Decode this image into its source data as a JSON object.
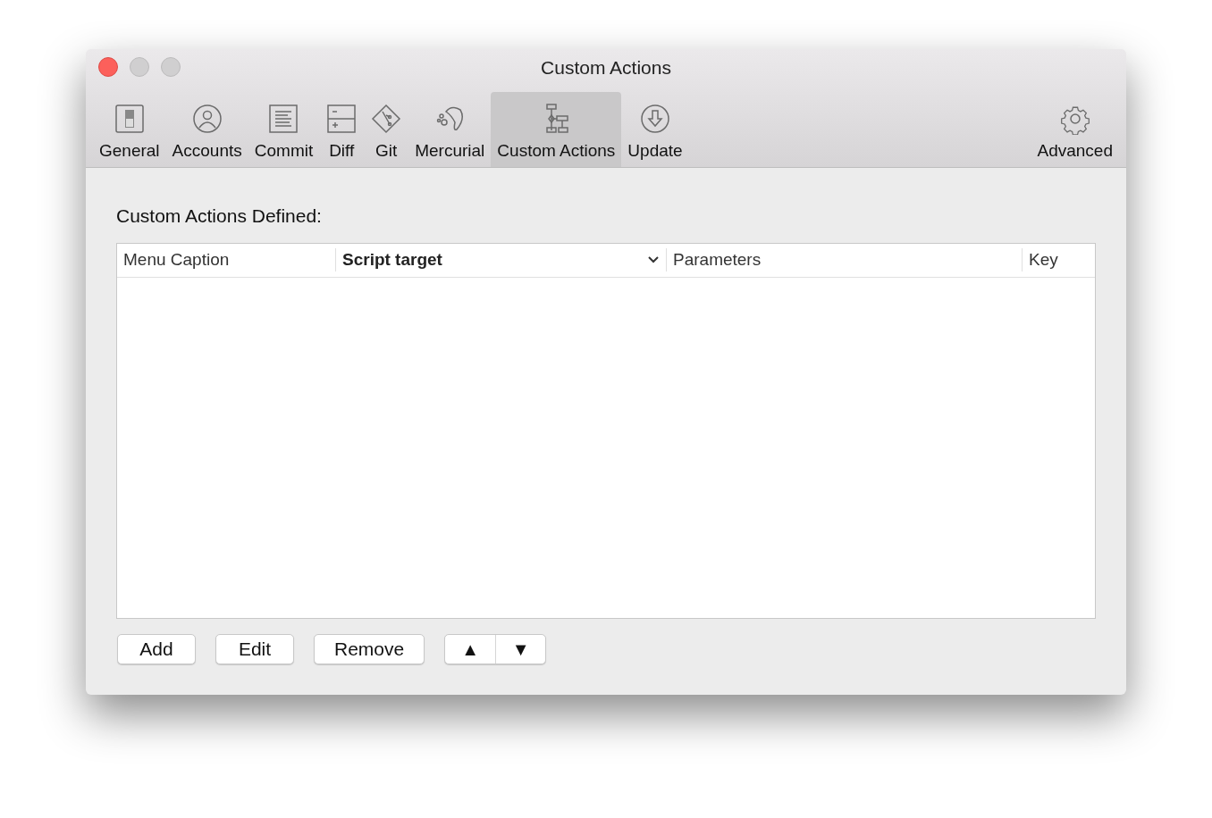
{
  "window": {
    "title": "Custom Actions"
  },
  "toolbar": [
    {
      "label": "General",
      "kind": "switch",
      "selected": false
    },
    {
      "label": "Accounts",
      "kind": "person",
      "selected": false
    },
    {
      "label": "Commit",
      "kind": "document",
      "selected": false
    },
    {
      "label": "Diff",
      "kind": "diff",
      "selected": false
    },
    {
      "label": "Git",
      "kind": "git",
      "selected": false
    },
    {
      "label": "Mercurial",
      "kind": "mercurial",
      "selected": false
    },
    {
      "label": "Custom Actions",
      "kind": "flow",
      "selected": true
    },
    {
      "label": "Update",
      "kind": "download",
      "selected": false
    },
    {
      "label": "Advanced",
      "kind": "gear",
      "selected": false
    }
  ],
  "section_title": "Custom Actions Defined:",
  "table": {
    "columns": [
      {
        "label": "Menu Caption",
        "sorted": false
      },
      {
        "label": "Script target",
        "sorted": true
      },
      {
        "label": "Parameters",
        "sorted": false
      },
      {
        "label": "Key",
        "sorted": false
      }
    ]
  },
  "buttons": [
    "Add",
    "Edit",
    "Remove"
  ],
  "move_buttons": [
    "▲",
    "▼"
  ]
}
